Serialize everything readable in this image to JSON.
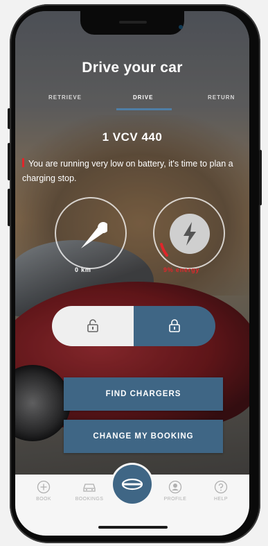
{
  "screen": {
    "title": "Drive your car",
    "tabs": [
      {
        "label": "RETRIEVE",
        "active": false
      },
      {
        "label": "DRIVE",
        "active": true
      },
      {
        "label": "RETURN",
        "active": false
      }
    ],
    "plate": "1 VCV 440",
    "warning": "You are running very low on battery, it's time to  plan a charging stop."
  },
  "gauges": {
    "distance": {
      "label": "0 km",
      "icon": "speedometer-needle-icon"
    },
    "energy": {
      "label": "9% energy",
      "level_percent": 9,
      "icon": "lightning-bolt-icon"
    }
  },
  "lock": {
    "unlock_icon": "unlock-icon",
    "lock_icon": "lock-icon",
    "selected": "lock"
  },
  "actions": {
    "find_chargers": "FIND CHARGERS",
    "change_booking": "CHANGE MY BOOKING"
  },
  "nav": {
    "items": [
      {
        "label": "BOOK",
        "icon": "plus-circle-icon"
      },
      {
        "label": "BOOKINGS",
        "icon": "car-icon"
      },
      {
        "label": "",
        "icon": "brand-logo-icon"
      },
      {
        "label": "PROFILE",
        "icon": "user-icon"
      },
      {
        "label": "HELP",
        "icon": "help-icon"
      }
    ]
  },
  "colors": {
    "accent": "#3f6685",
    "tab_underline": "#4f7ea6",
    "warning": "#e0262b",
    "energy": "#e0262b"
  }
}
